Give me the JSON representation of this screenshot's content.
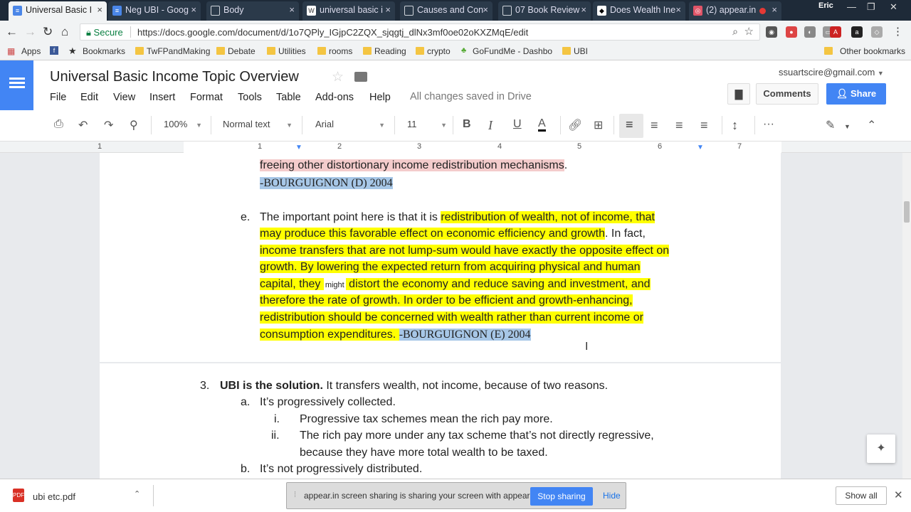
{
  "tabs": [
    {
      "title": "Universal Basic I",
      "icon": "D"
    },
    {
      "title": "Neg UBI - Goog",
      "icon": "D"
    },
    {
      "title": "Body",
      "icon": "page"
    },
    {
      "title": "universal basic i",
      "icon": "W"
    },
    {
      "title": "Causes and Con",
      "icon": "page"
    },
    {
      "title": "07 Book Review",
      "icon": "page"
    },
    {
      "title": "Does Wealth Ine",
      "icon": "page"
    },
    {
      "title": "(2) appear.in",
      "icon": "page"
    }
  ],
  "profile_name": "Eric",
  "address": {
    "secure_label": "Secure",
    "url": "https://docs.google.com/document/d/1o7QPly_IGjpC2ZQX_sjqgtj_dlNx3mf0oe02oKXZMqE/edit"
  },
  "bookmarks": {
    "items": [
      "Apps",
      "Bookmarks",
      "TwFPandMaking",
      "Debate",
      "Utilities",
      "rooms",
      "Reading",
      "crypto",
      "GoFundMe - Dashbo",
      "UBI"
    ],
    "other": "Other bookmarks"
  },
  "doc": {
    "title": "Universal Basic Income Topic Overview",
    "account": "ssuartscire@gmail.com",
    "menu": [
      "File",
      "Edit",
      "View",
      "Insert",
      "Format",
      "Tools",
      "Table",
      "Add-ons",
      "Help"
    ],
    "saved_status": "All changes saved in Drive",
    "comments_label": "Comments",
    "share_label": "Share"
  },
  "toolbar": {
    "zoom": "100%",
    "style": "Normal text",
    "font": "Arial",
    "size": "11",
    "bold": "B",
    "italic": "I",
    "underline": "U",
    "textcolor": "A",
    "more": "···"
  },
  "ruler": {
    "numbers": [
      "1",
      "1",
      "2",
      "3",
      "4",
      "5",
      "6",
      "7"
    ]
  },
  "content": {
    "d_tail": "freeing other distortionary income redistribution mechanisms",
    "d_period": ".",
    "d_cite": "-BOURGUIGNON (D) 2004",
    "e_marker": "e.",
    "e_l1a": "The important point here is that it is ",
    "e_l1b": "redistribution of wealth, not of income, that",
    "e_l2a": "may produce this favorable effect on economic efficiency and growth",
    "e_l2b": ". In fact,",
    "e_l3": "income transfers that are not lump-sum would have exactly the opposite effect on",
    "e_l4": "growth. By lowering the expected return from acquiring physical and human",
    "e_l5a": "capital, they ",
    "e_l5b": "might",
    "e_l5c": " distort the economy and reduce saving and investment, and",
    "e_l6": "therefore the rate of growth. In order to be efficient and growth-enhancing,",
    "e_l7": "redistribution should be concerned with wealth rather than current income or",
    "e_l8a": "consumption expenditures.",
    "e_l8b": " ",
    "e_cite": "-BOURGUIGNON (E) 2004",
    "s3_marker": "3.",
    "s3_bold": "UBI is the solution.",
    "s3_rest": "  It transfers wealth, not income, because of two reasons.",
    "a_marker": "a.",
    "a_text": "It’s progressively collected.",
    "i_marker": "i.",
    "i_text": "Progressive tax schemes mean the rich pay more.",
    "ii_marker": "ii.",
    "ii_l1": "The rich pay more under any tax scheme that’s not directly regressive,",
    "ii_l2": "because they have more total wealth to be taxed.",
    "b_marker": "b.",
    "b_text": "It’s not progressively distributed."
  },
  "downloads": {
    "file": "ubi etc.pdf",
    "show_all": "Show all"
  },
  "sharing_bar": {
    "text": "appear.in screen sharing is sharing your screen with appear.in.",
    "stop": "Stop sharing",
    "hide": "Hide"
  },
  "colors": {
    "highlight": "#ffff00",
    "pink_highlight": "#f4cccc",
    "selection": "#a7c7e7",
    "docs_blue": "#4285f4",
    "secure_green": "#0b8043"
  }
}
